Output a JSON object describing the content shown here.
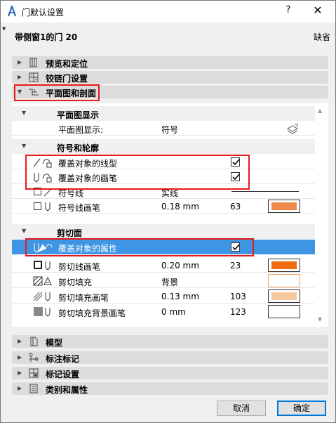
{
  "window": {
    "title": "门默认设置",
    "help_label": "?",
    "close_label": "✕"
  },
  "object": {
    "name": "带侧窗1的门 20",
    "default_label": "缺省"
  },
  "sections_top": [
    {
      "label": "预览和定位",
      "icon": "door-preview-icon",
      "expanded": false
    },
    {
      "label": "铰链门设置",
      "icon": "hinge-door-icon",
      "expanded": false
    },
    {
      "label": "平面图和剖面",
      "icon": "floor-plan-section-icon",
      "expanded": true
    }
  ],
  "panel": {
    "groups": {
      "display": {
        "label": "平面图显示"
      },
      "symbol": {
        "label": "符号和轮廓"
      },
      "cut": {
        "label": "剪切面"
      }
    },
    "rows": {
      "plan_display": {
        "label": "平面图显示:",
        "value": "符号"
      },
      "override_linetype": {
        "label": "覆盖对象的线型",
        "checked": true
      },
      "override_pen": {
        "label": "覆盖对象的画笔",
        "checked": true
      },
      "symbol_line": {
        "label": "符号线",
        "value": "实线"
      },
      "symbol_line_pen": {
        "label": "符号线画笔",
        "value": "0.18 mm",
        "num": "63",
        "color": "#f0894a"
      },
      "override_attr": {
        "label": "覆盖对象的属性",
        "checked": true
      },
      "cut_line_pen": {
        "label": "剪切线画笔",
        "value": "0.20 mm",
        "num": "23",
        "color": "#f06a10"
      },
      "cut_fill": {
        "label": "剪切填充",
        "value": "背景",
        "color": "#ffffff",
        "border": "#f0a060"
      },
      "cut_fill_pen": {
        "label": "剪切填充画笔",
        "value": "0.13 mm",
        "num": "103",
        "color": "#f8c8a0"
      },
      "cut_fill_bg_pen": {
        "label": "剪切填充背景画笔",
        "value": "0 mm",
        "num": "123",
        "color": "#ffffff"
      }
    }
  },
  "sections_bottom": [
    {
      "label": "模型",
      "icon": "model-icon"
    },
    {
      "label": "标注标记",
      "icon": "dimension-marker-icon"
    },
    {
      "label": "标记设置",
      "icon": "marker-settings-icon"
    },
    {
      "label": "类别和属性",
      "icon": "category-properties-icon"
    }
  ],
  "buttons": {
    "cancel": "取消",
    "ok": "确定"
  },
  "colors": {
    "highlight": "#e8191a",
    "selected_row": "#3d95e4",
    "accent_blue": "#0078d7"
  }
}
